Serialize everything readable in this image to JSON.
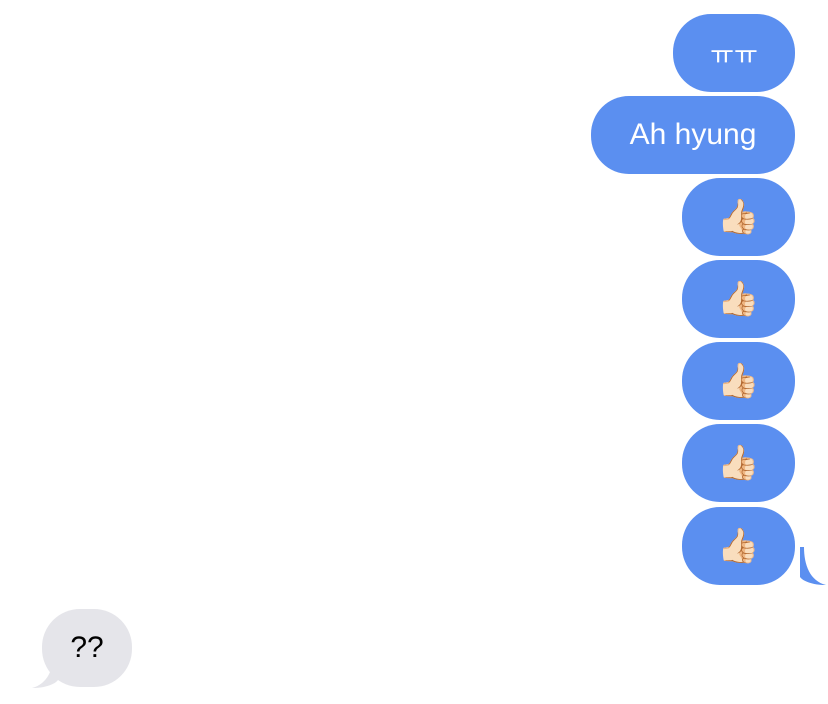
{
  "messages": {
    "sent": [
      {
        "text": "ㅠㅠ"
      },
      {
        "text": "Ah hyung"
      },
      {
        "text": "👍🏻"
      },
      {
        "text": "👍🏻"
      },
      {
        "text": "👍🏻"
      },
      {
        "text": "👍🏻"
      },
      {
        "text": "👍🏻"
      }
    ],
    "received": [
      {
        "text": "??"
      }
    ]
  },
  "colors": {
    "sent_bubble": "#5b8ff0",
    "received_bubble": "#e5e5ea",
    "background": "#ffffff"
  }
}
